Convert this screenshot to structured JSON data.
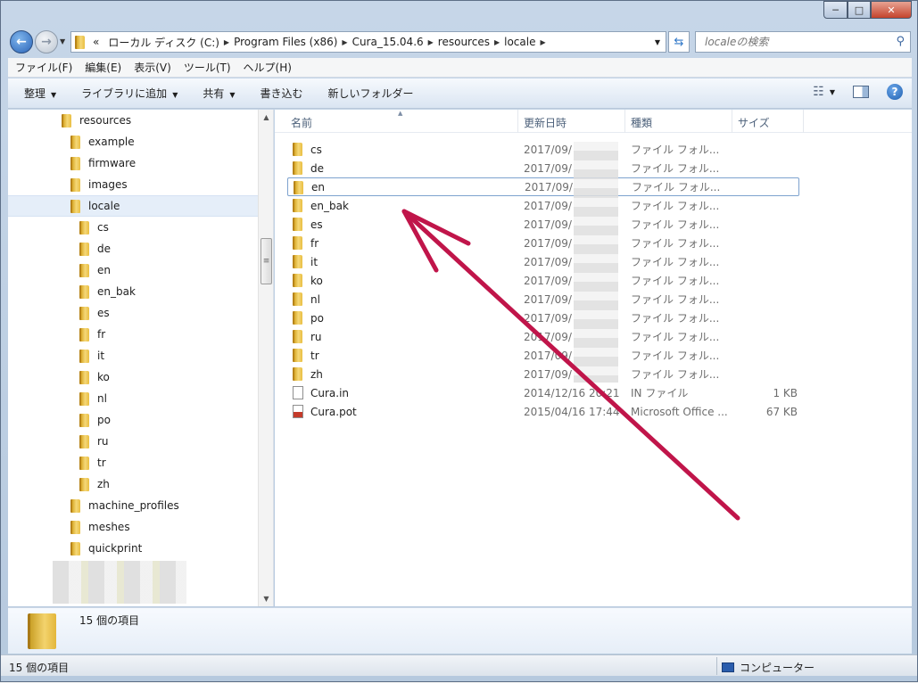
{
  "address": {
    "prefix": "«",
    "segments": [
      "ローカル ディスク (C:)",
      "Program Files (x86)",
      "Cura_15.04.6",
      "resources",
      "locale"
    ]
  },
  "search": {
    "placeholder": "localeの検索"
  },
  "menu": [
    "ファイル(F)",
    "編集(E)",
    "表示(V)",
    "ツール(T)",
    "ヘルプ(H)"
  ],
  "toolbar": {
    "organize": "整理",
    "library": "ライブラリに追加",
    "share": "共有",
    "burn": "書き込む",
    "new_folder": "新しいフォルダー"
  },
  "nav": {
    "items": [
      {
        "label": "resources",
        "depth": 0
      },
      {
        "label": "example",
        "depth": 1
      },
      {
        "label": "firmware",
        "depth": 1
      },
      {
        "label": "images",
        "depth": 1
      },
      {
        "label": "locale",
        "depth": 1,
        "selected": true
      },
      {
        "label": "cs",
        "depth": 2
      },
      {
        "label": "de",
        "depth": 2
      },
      {
        "label": "en",
        "depth": 2
      },
      {
        "label": "en_bak",
        "depth": 2
      },
      {
        "label": "es",
        "depth": 2
      },
      {
        "label": "fr",
        "depth": 2
      },
      {
        "label": "it",
        "depth": 2
      },
      {
        "label": "ko",
        "depth": 2
      },
      {
        "label": "nl",
        "depth": 2
      },
      {
        "label": "po",
        "depth": 2
      },
      {
        "label": "ru",
        "depth": 2
      },
      {
        "label": "tr",
        "depth": 2
      },
      {
        "label": "zh",
        "depth": 2
      },
      {
        "label": "machine_profiles",
        "depth": 1
      },
      {
        "label": "meshes",
        "depth": 1
      },
      {
        "label": "quickprint",
        "depth": 1
      }
    ]
  },
  "columns": {
    "name": "名前",
    "date": "更新日時",
    "type": "種類",
    "size": "サイズ"
  },
  "files": [
    {
      "name": "cs",
      "date": "2017/09/",
      "type": "ファイル フォル...",
      "size": "",
      "icon": "folder"
    },
    {
      "name": "de",
      "date": "2017/09/",
      "type": "ファイル フォル...",
      "size": "",
      "icon": "folder"
    },
    {
      "name": "en",
      "date": "2017/09/",
      "type": "ファイル フォル...",
      "size": "",
      "icon": "folder",
      "selected": true
    },
    {
      "name": "en_bak",
      "date": "2017/09/",
      "type": "ファイル フォル...",
      "size": "",
      "icon": "folder"
    },
    {
      "name": "es",
      "date": "2017/09/",
      "type": "ファイル フォル...",
      "size": "",
      "icon": "folder"
    },
    {
      "name": "fr",
      "date": "2017/09/",
      "type": "ファイル フォル...",
      "size": "",
      "icon": "folder"
    },
    {
      "name": "it",
      "date": "2017/09/",
      "type": "ファイル フォル...",
      "size": "",
      "icon": "folder"
    },
    {
      "name": "ko",
      "date": "2017/09/",
      "type": "ファイル フォル...",
      "size": "",
      "icon": "folder"
    },
    {
      "name": "nl",
      "date": "2017/09/",
      "type": "ファイル フォル...",
      "size": "",
      "icon": "folder"
    },
    {
      "name": "po",
      "date": "2017/09/",
      "type": "ファイル フォル...",
      "size": "",
      "icon": "folder"
    },
    {
      "name": "ru",
      "date": "2017/09/",
      "type": "ファイル フォル...",
      "size": "",
      "icon": "folder"
    },
    {
      "name": "tr",
      "date": "2017/09/",
      "type": "ファイル フォル...",
      "size": "",
      "icon": "folder"
    },
    {
      "name": "zh",
      "date": "2017/09/",
      "type": "ファイル フォル...",
      "size": "",
      "icon": "folder"
    },
    {
      "name": "Cura.in",
      "date": "2014/12/16 20:21",
      "type": "IN ファイル",
      "size": "1 KB",
      "icon": "file"
    },
    {
      "name": "Cura.pot",
      "date": "2015/04/16 17:44",
      "type": "Microsoft Office ...",
      "size": "67 KB",
      "icon": "pot"
    }
  ],
  "details": {
    "count": "15 個の項目"
  },
  "status": {
    "left": "15 個の項目",
    "right": "コンピューター"
  },
  "colors": {
    "arrow": "#c0154a",
    "selection_border": "#7da2ce"
  }
}
